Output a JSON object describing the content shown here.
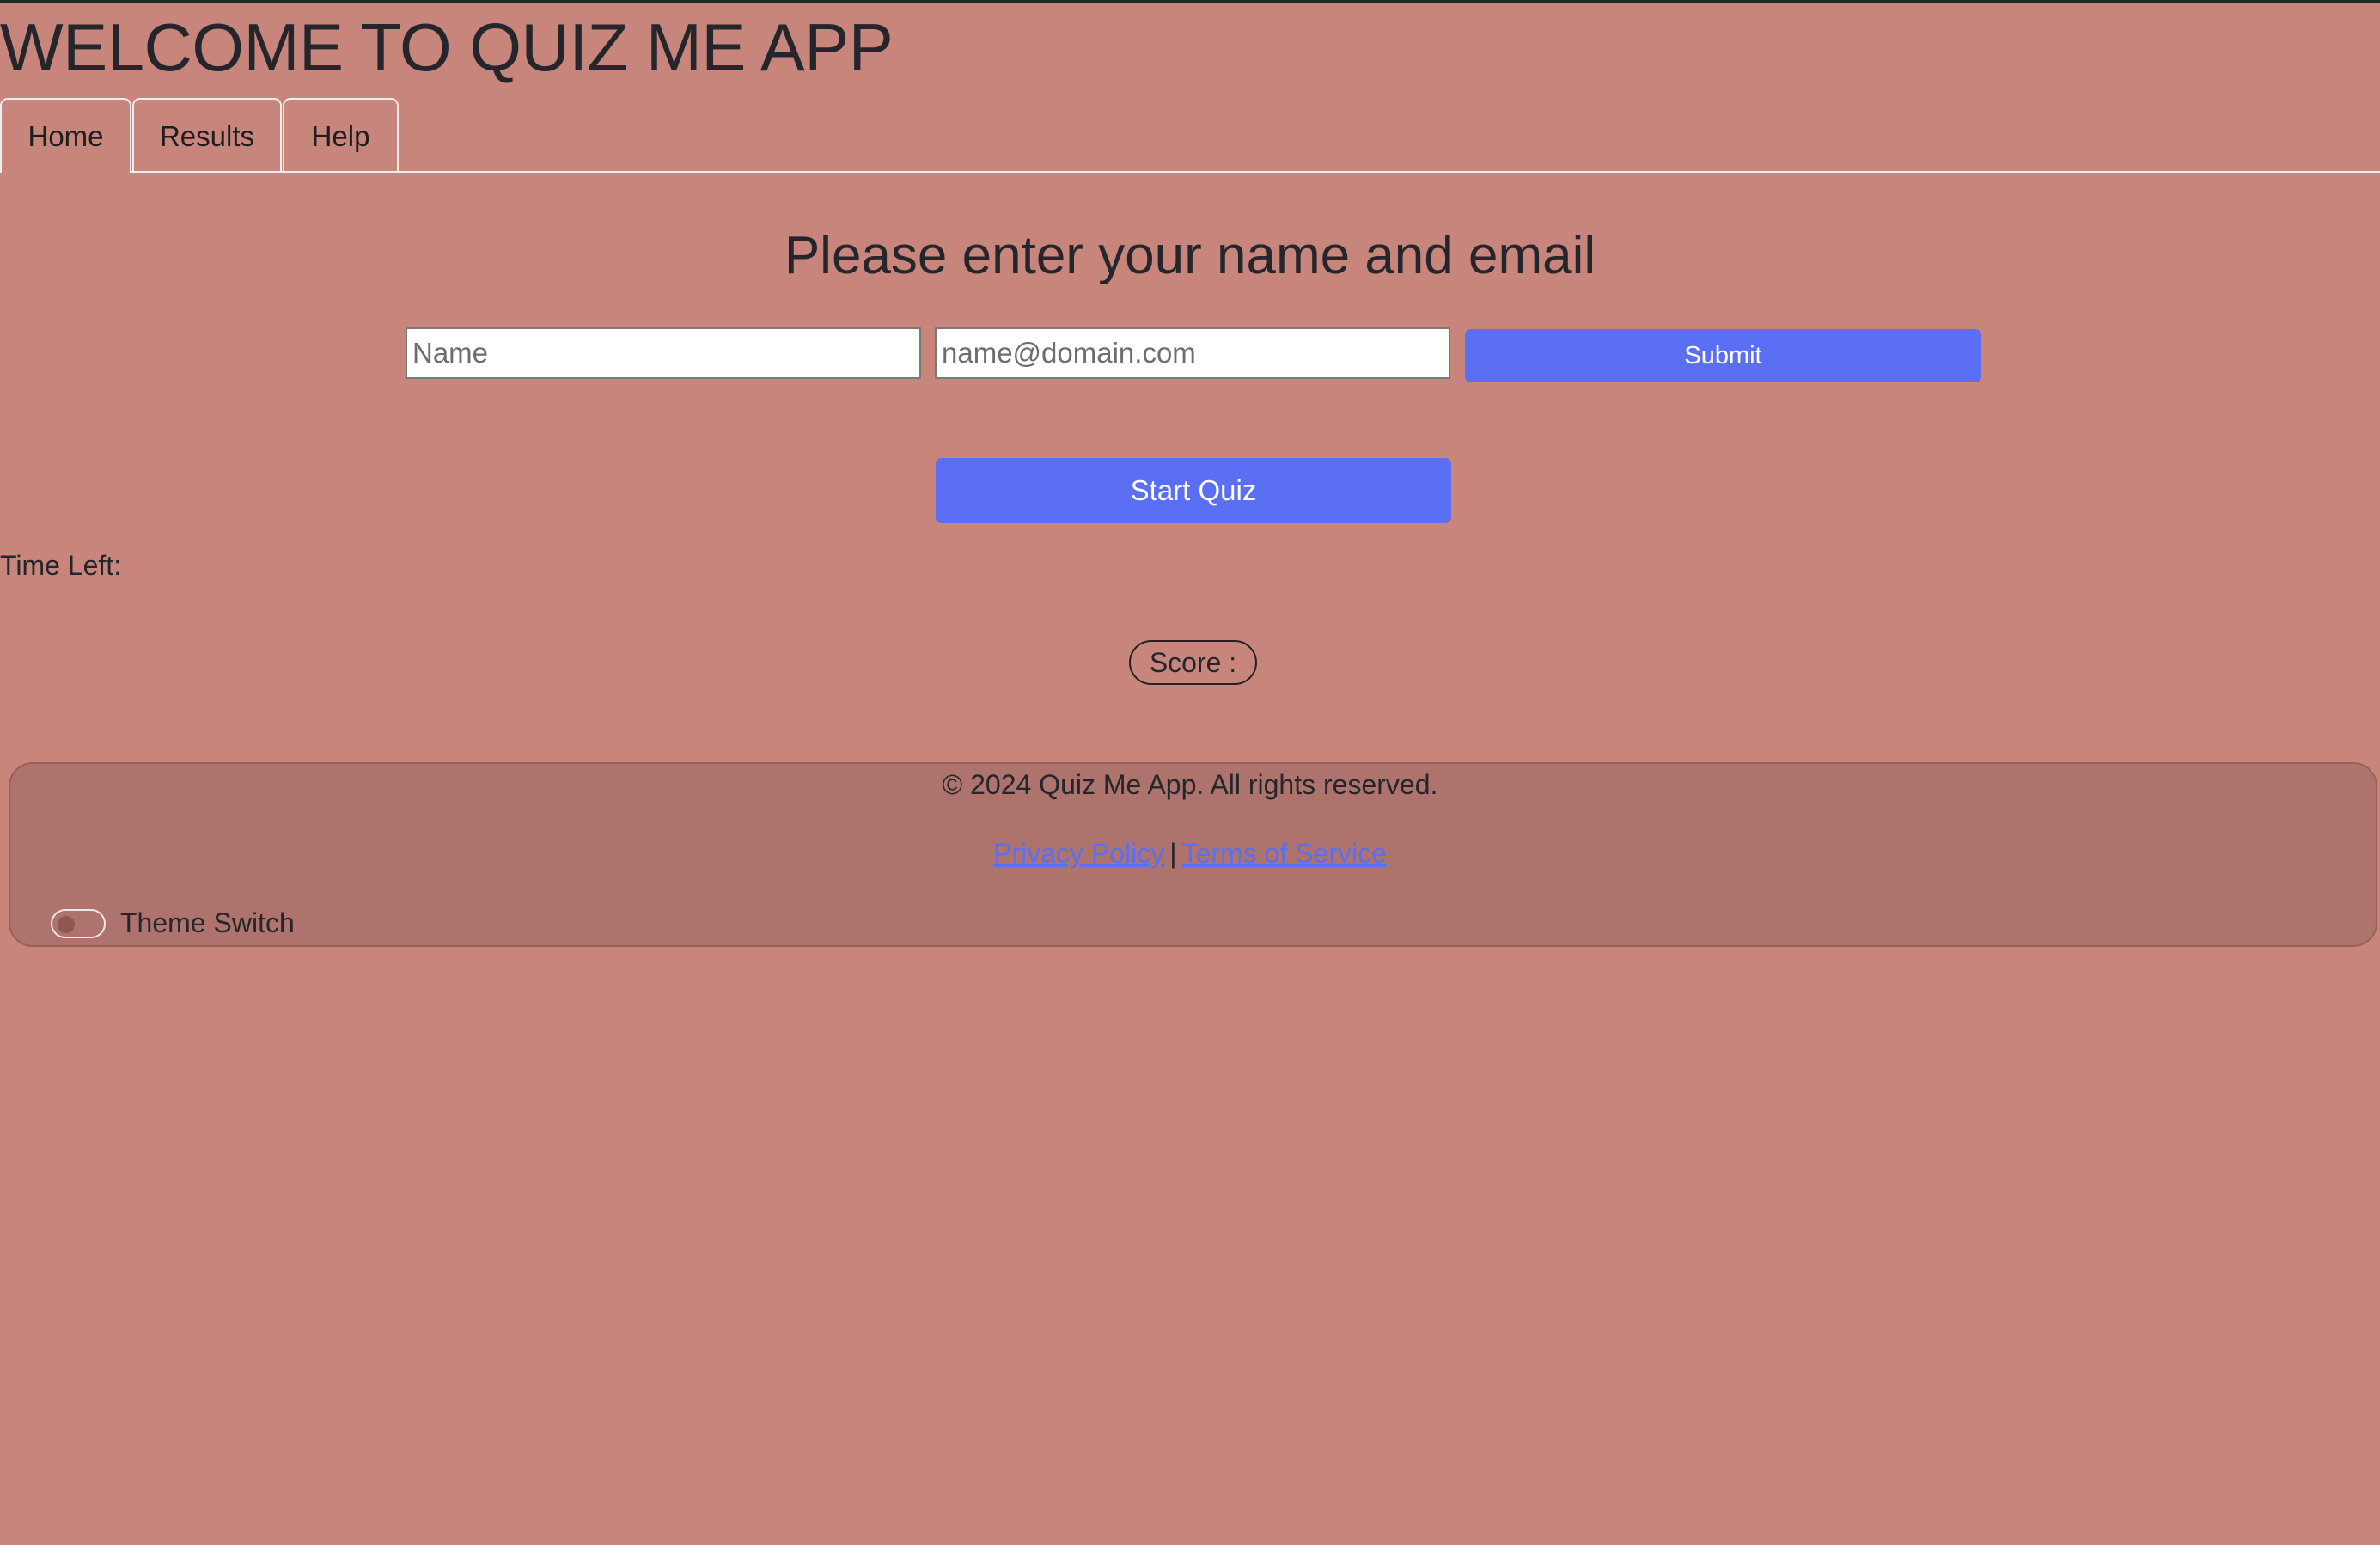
{
  "header": {
    "title": "WELCOME TO QUIZ ME APP"
  },
  "tabs": [
    {
      "label": "Home",
      "active": true
    },
    {
      "label": "Results",
      "active": false
    },
    {
      "label": "Help",
      "active": false
    }
  ],
  "form": {
    "heading": "Please enter your name and email",
    "name_placeholder": "Name",
    "name_value": "",
    "email_placeholder": "name@domain.com",
    "email_value": "",
    "submit_label": "Submit"
  },
  "quiz": {
    "start_label": "Start Quiz",
    "timer_label": "Time Left:",
    "score_label": "Score :"
  },
  "footer": {
    "copyright": "© 2024 Quiz Me App. All rights reserved.",
    "privacy_label": "Privacy Policy",
    "separator": "|",
    "terms_label": "Terms of Service",
    "theme_switch_label": "Theme Switch",
    "theme_switch_on": false
  },
  "colors": {
    "page_background": "#c8857c",
    "footer_background": "#ad736c",
    "accent": "#5a6ff4",
    "text": "#24262c"
  },
  "icons": {
    "toggle": "toggle-switch-icon"
  }
}
